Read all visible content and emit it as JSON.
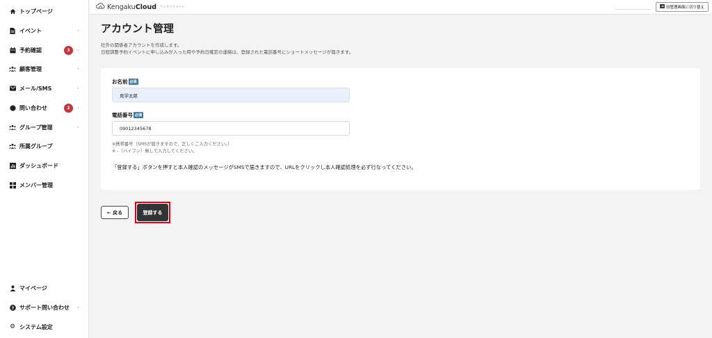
{
  "sidebar": {
    "items": [
      {
        "label": "トップページ",
        "icon": "home-icon",
        "chevron": false,
        "badge": ""
      },
      {
        "label": "イベント",
        "icon": "document-icon",
        "chevron": true,
        "badge": ""
      },
      {
        "label": "予約確認",
        "icon": "calendar-icon",
        "chevron": true,
        "badge": "3"
      },
      {
        "label": "顧客管理",
        "icon": "people-icon",
        "chevron": true,
        "badge": ""
      },
      {
        "label": "メール/SMS",
        "icon": "mail-icon",
        "chevron": true,
        "badge": ""
      },
      {
        "label": "問い合わせ",
        "icon": "chat-icon",
        "chevron": true,
        "badge": "2"
      },
      {
        "label": "グループ管理",
        "icon": "group-icon",
        "chevron": true,
        "badge": ""
      },
      {
        "label": "所属グループ",
        "icon": "group-icon",
        "chevron": false,
        "badge": ""
      },
      {
        "label": "ダッシュボード",
        "icon": "chart-icon",
        "chevron": false,
        "badge": ""
      },
      {
        "label": "メンバー管理",
        "icon": "grid-icon",
        "chevron": false,
        "badge": ""
      }
    ],
    "bottom_items": [
      {
        "label": "マイページ",
        "icon": "person-icon",
        "chevron": false
      },
      {
        "label": "サポート問い合わせ",
        "icon": "help-icon",
        "chevron": true
      },
      {
        "label": "システム設定",
        "icon": "gear-icon",
        "chevron": false
      }
    ]
  },
  "header": {
    "brand_light": "Kengaku",
    "brand_bold": "Cloud",
    "brand_sub": "ケンガククラウド",
    "switch_label": "旧管理画面に切り替え"
  },
  "main": {
    "title": "アカウント管理",
    "desc1": "社外の関係者アカウントを作成します。",
    "desc2": "日程調整予約イベントに申し込みが入った時や予約日確定の連絡は、登録された電話番号にショートメッセージが届きます。",
    "form": {
      "name_label": "お名前",
      "required_tag": "必須",
      "name_value": "見学太郎",
      "phone_label": "電話番号",
      "phone_value": "09012345678",
      "note1": "※携帯番号（SMSが届きますので、正しくご入力ください。）",
      "note2": "※ -（ハイフン）無しで入力してください。",
      "info": "「登録する」ボタンを押すと本人確認のメッセージがSMSで届きますので、URLをクリックし本人確認処理を必ず行なってください。"
    },
    "back_label": "← 戻る",
    "submit_label": "登録する"
  },
  "colors": {
    "badge": "#c0373f",
    "required_tag": "#3f79a0",
    "submit": "#333333",
    "highlight": "#e3001b",
    "input_filled": "#e9f0fc"
  }
}
